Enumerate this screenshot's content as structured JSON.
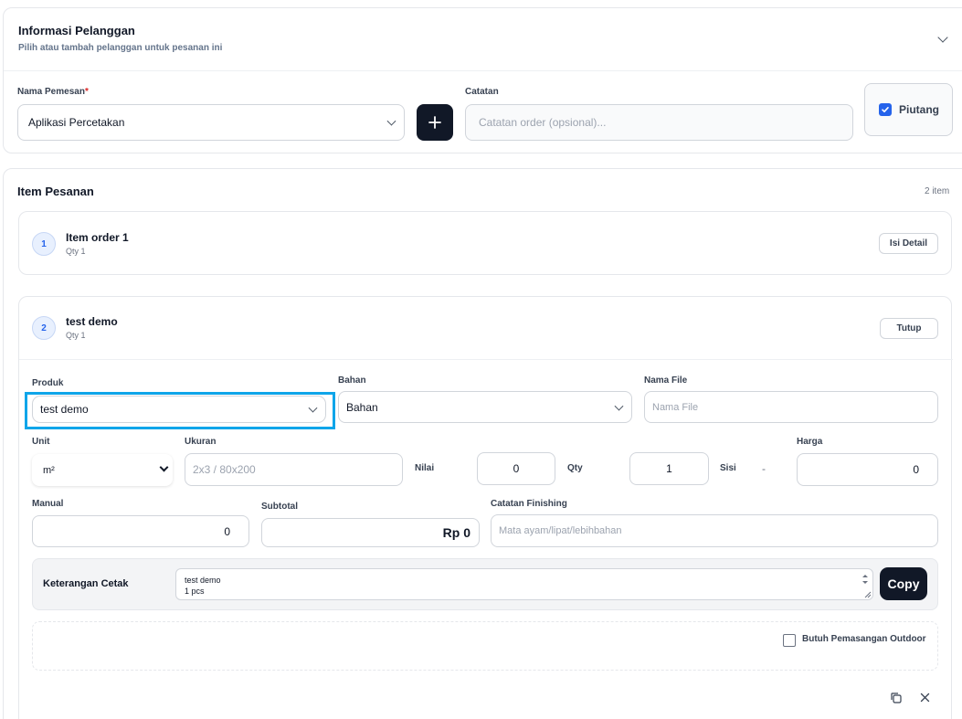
{
  "customer": {
    "title": "Informasi Pelanggan",
    "subtitle": "Pilih atau tambah pelanggan untuk pesanan ini",
    "name_label": "Nama Pemesan",
    "required_mark": "*",
    "name_value": "Aplikasi Percetakan",
    "add_label": "+",
    "note_label": "Catatan",
    "note_placeholder": "Catatan order (opsional)...",
    "piutang_label": "Piutang",
    "piutang_checked": true
  },
  "items": {
    "title": "Item Pesanan",
    "count": "2 item",
    "list": [
      {
        "num": "1",
        "name": "Item order 1",
        "qty": "Qty 1",
        "action": "Isi Detail"
      },
      {
        "num": "2",
        "name": "test demo",
        "qty": "Qty 1",
        "action": "Tutup"
      }
    ]
  },
  "detail": {
    "produk_label": "Produk",
    "produk_value": "test demo",
    "bahan_label": "Bahan",
    "bahan_value": "Bahan",
    "namafile_label": "Nama File",
    "namafile_placeholder": "Nama File",
    "unit_label": "Unit",
    "unit_value": "m²",
    "ukuran_label": "Ukuran",
    "ukuran_placeholder": "2x3 / 80x200",
    "nilai_label": "Nilai",
    "nilai_value": "0",
    "qty_label": "Qty",
    "qty_value": "1",
    "sisi_label": "Sisi",
    "sisi_value": "-",
    "harga_label": "Harga",
    "harga_value": "0",
    "manual_label": "Manual",
    "manual_value": "0",
    "subtotal_label": "Subtotal",
    "subtotal_value": "Rp 0",
    "finishing_label": "Catatan Finishing",
    "finishing_placeholder": "Mata ayam/lipat/lebihbahan",
    "keterangan_label": "Keterangan Cetak",
    "keterangan_line1": "test demo",
    "keterangan_line2": "1 pcs",
    "copy_label": "Copy",
    "outdoor_label": "Butuh Pemasangan Outdoor"
  },
  "colors": {
    "accent": "#2563eb",
    "highlight": "#0ea5e9",
    "dark": "#111827"
  }
}
